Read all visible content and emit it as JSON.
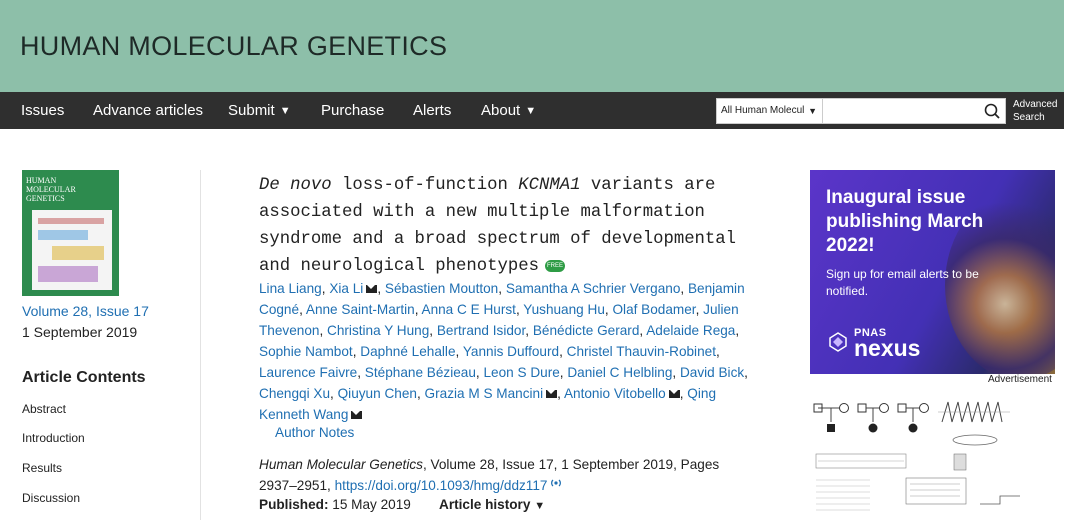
{
  "journal": {
    "title": "HUMAN MOLECULAR GENETICS"
  },
  "nav": {
    "items": [
      "Issues",
      "Advance articles",
      "Submit",
      "Purchase",
      "Alerts",
      "About"
    ],
    "search_scope": "All Human Molecul",
    "search_placeholder": "",
    "advanced_search": "Advanced Search"
  },
  "issue": {
    "cover_title": "HUMAN MOLECULAR GENETICS",
    "volume_link": "Volume 28, Issue 17",
    "date": "1 September 2019"
  },
  "article_contents": {
    "heading": "Article Contents",
    "items": [
      "Abstract",
      "Introduction",
      "Results",
      "Discussion"
    ]
  },
  "article": {
    "title_parts": [
      "De novo",
      " loss-of-function ",
      "KCNMA1",
      " variants are associated with a new multiple malformation syndrome and a broad spectrum of developmental and neurological phenotypes"
    ],
    "free_badge": "FREE",
    "authors": [
      "Lina Liang",
      "Xia Li",
      "Sébastien Moutton",
      "Samantha A Schrier Vergano",
      "Benjamin Cogné",
      "Anne Saint-Martin",
      "Anna C E Hurst",
      "Yushuang Hu",
      "Olaf Bodamer",
      "Julien Thevenon",
      "Christina Y Hung",
      "Bertrand Isidor",
      "Bénédicte Gerard",
      "Adelaide Rega",
      "Sophie Nambot",
      "Daphné Lehalle",
      "Yannis Duffourd",
      "Christel Thauvin-Robinet",
      "Laurence Faivre",
      "Stéphane Bézieau",
      "Leon S Dure",
      "Daniel C Helbling",
      "David Bick",
      "Chengqi Xu",
      "Qiuyun Chen",
      "Grazia M S Mancini",
      "Antonio Vitobello",
      "Qing Kenneth Wang"
    ],
    "author_notes": "Author Notes",
    "citation_journal": "Human Molecular Genetics",
    "citation_rest": ", Volume 28, Issue 17, 1 September 2019, Pages 2937–2951, ",
    "doi": "https://doi.org/10.1093/hmg/ddz117",
    "published_label": "Published:",
    "published_date": "15 May 2019",
    "history_label": "Article history"
  },
  "ad": {
    "headline": "Inaugural issue publishing March 2022!",
    "sub": "Sign up for email alerts to be notified.",
    "brand_small": "PNAS",
    "brand_big": "nexus",
    "label": "Advertisement"
  },
  "colors": {
    "masthead": "#8dbfa9",
    "navbar": "#2f2f2f",
    "link": "#1f6fb2",
    "ad": "#4a32be"
  }
}
